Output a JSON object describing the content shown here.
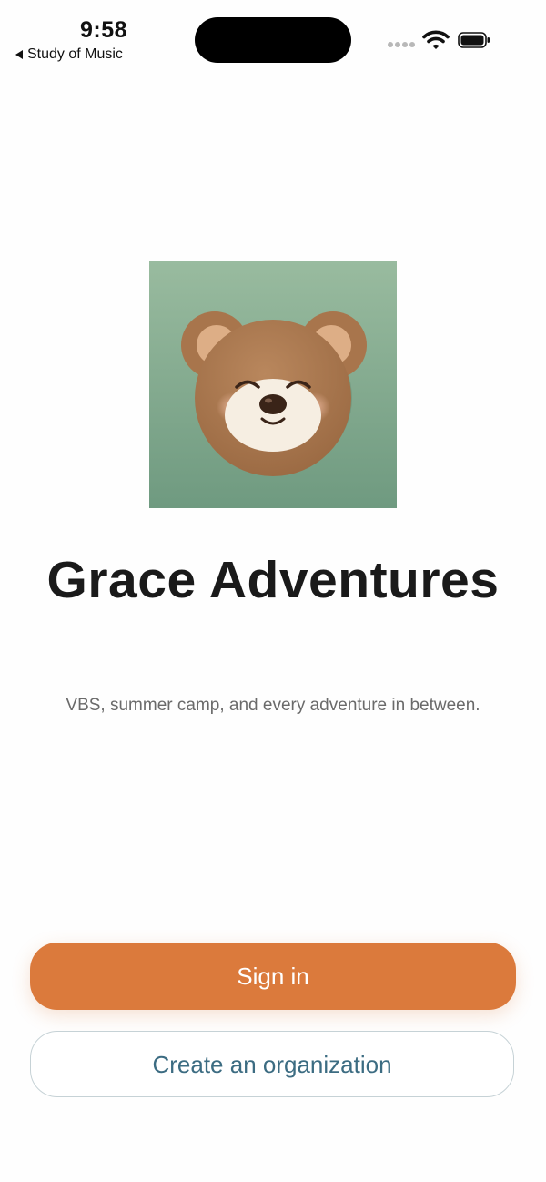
{
  "status_bar": {
    "time": "9:58",
    "back_app": "Study of Music",
    "signal_icon": "cellular-signal-icon",
    "wifi_icon": "wifi-icon",
    "battery_icon": "battery-icon"
  },
  "hero": {
    "image_icon": "bear-illustration",
    "title": "Grace Adventures",
    "tagline": "VBS, summer camp, and every adventure in between."
  },
  "actions": {
    "sign_in_label": "Sign in",
    "create_org_label": "Create an organization"
  },
  "colors": {
    "accent": "#db7a3c",
    "secondary_text": "#3c6c82",
    "art_background": "#8fb39a",
    "bear_fur": "#a8754c"
  }
}
